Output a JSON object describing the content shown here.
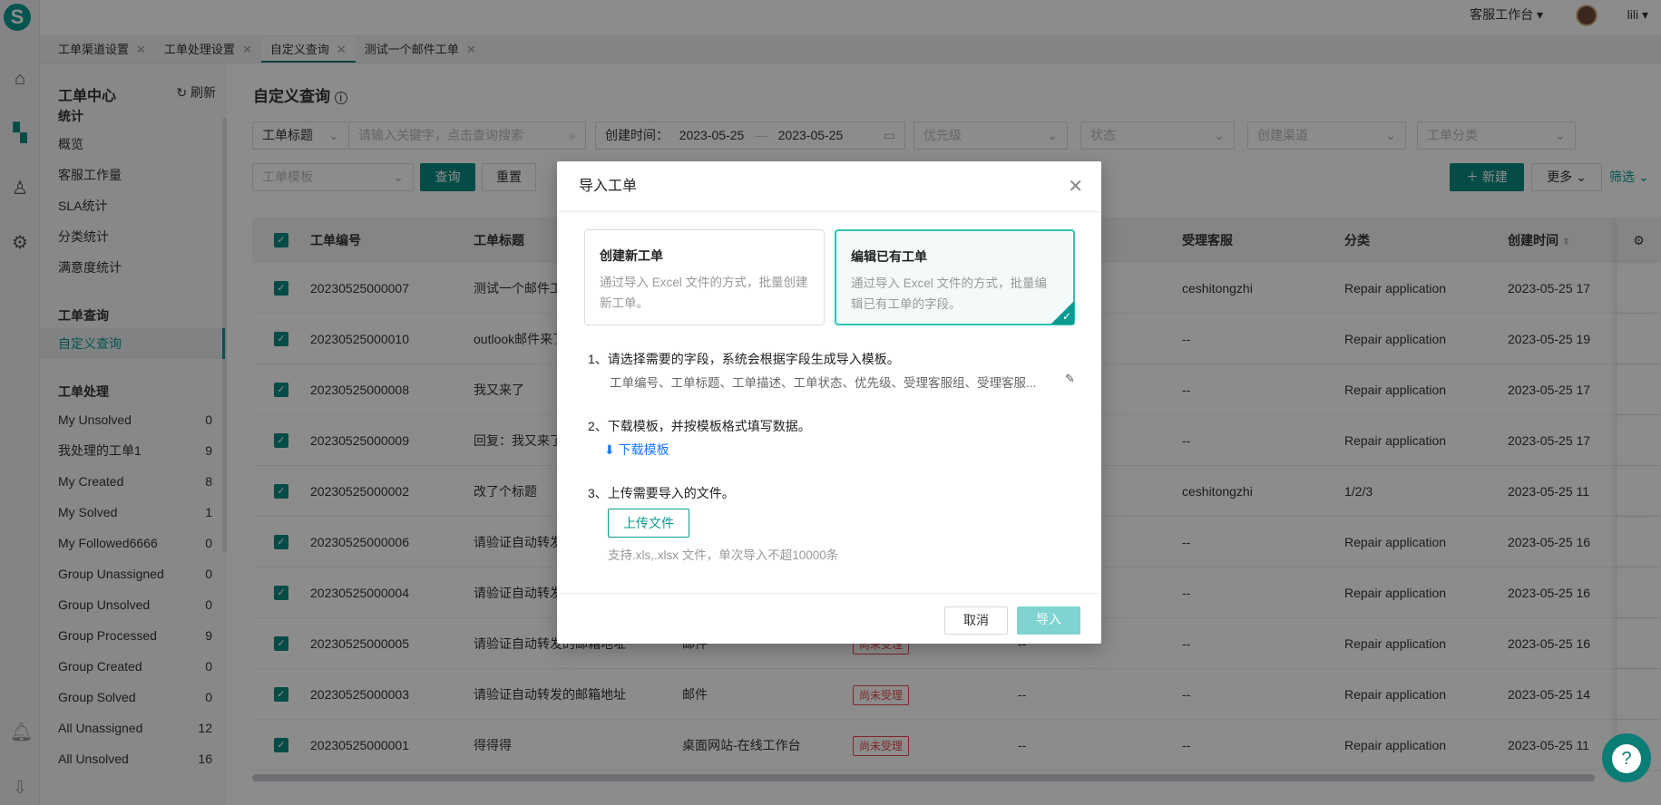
{
  "app": {
    "logo_letter": "S",
    "workspace": "客服工作台",
    "user": "lili"
  },
  "tabs": [
    {
      "label": "工单渠道设置"
    },
    {
      "label": "工单处理设置"
    },
    {
      "label": "自定义查询",
      "active": true
    },
    {
      "label": "测试一个邮件工单"
    }
  ],
  "sidebar": {
    "title": "工单中心",
    "refresh": "刷新",
    "groups": [
      {
        "label": "统计",
        "items": [
          {
            "label": "概览"
          },
          {
            "label": "客服工作量"
          },
          {
            "label": "SLA统计"
          },
          {
            "label": "分类统计"
          },
          {
            "label": "满意度统计"
          }
        ]
      },
      {
        "label": "工单查询",
        "items": [
          {
            "label": "自定义查询",
            "active": true
          }
        ]
      },
      {
        "label": "工单处理",
        "items": [
          {
            "label": "My Unsolved",
            "count": "0"
          },
          {
            "label": "我处理的工单1",
            "count": "9"
          },
          {
            "label": "My Created",
            "count": "8"
          },
          {
            "label": "My Solved",
            "count": "1"
          },
          {
            "label": "My Followed6666",
            "count": "0"
          },
          {
            "label": "Group Unassigned",
            "count": "0"
          },
          {
            "label": "Group Unsolved",
            "count": "0"
          },
          {
            "label": "Group Processed",
            "count": "9"
          },
          {
            "label": "Group Created",
            "count": "0"
          },
          {
            "label": "Group Solved",
            "count": "0"
          },
          {
            "label": "All Unassigned",
            "count": "12"
          },
          {
            "label": "All Unsolved",
            "count": "16"
          }
        ]
      }
    ]
  },
  "main": {
    "title": "自定义查询",
    "filters": {
      "field_select": "工单标题",
      "search_placeholder": "请输入关键字，点击查询搜索",
      "created_label": "创建时间：",
      "date_from": "2023-05-25",
      "date_to": "2023-05-25",
      "priority": "优先级",
      "status": "状态",
      "channel": "创建渠道",
      "category": "工单分类",
      "template": "工单模板",
      "query": "查询",
      "reset": "重置"
    },
    "actions": {
      "new": "新建",
      "more": "更多",
      "filter": "筛选"
    },
    "table": {
      "headers": {
        "id": "工单编号",
        "title": "工单标题",
        "agent": "受理客服",
        "category": "分类",
        "created": "创建时间"
      },
      "rows": [
        {
          "id": "20230525000007",
          "title": "测试一个邮件工单",
          "channel": "",
          "status": "",
          "c5": "",
          "agent": "ceshitongzhi",
          "category": "Repair application",
          "created": "2023-05-25 17"
        },
        {
          "id": "20230525000010",
          "title": "outlook邮件来了",
          "channel": "",
          "status": "",
          "c5": "",
          "agent": "--",
          "category": "Repair application",
          "created": "2023-05-25 19"
        },
        {
          "id": "20230525000008",
          "title": "我又来了",
          "channel": "",
          "status": "",
          "c5": "",
          "agent": "--",
          "category": "Repair application",
          "created": "2023-05-25 17"
        },
        {
          "id": "20230525000009",
          "title": "回复：我又来了",
          "channel": "",
          "status": "",
          "c5": "",
          "agent": "--",
          "category": "Repair application",
          "created": "2023-05-25 17"
        },
        {
          "id": "20230525000002",
          "title": "改了个标题",
          "channel": "",
          "status": "",
          "c5": "",
          "agent": "ceshitongzhi",
          "category": "1/2/3",
          "created": "2023-05-25 11"
        },
        {
          "id": "20230525000006",
          "title": "请验证自动转发的邮箱地址",
          "channel": "",
          "status": "",
          "c5": "",
          "agent": "--",
          "category": "Repair application",
          "created": "2023-05-25 16"
        },
        {
          "id": "20230525000004",
          "title": "请验证自动转发的邮箱地址",
          "channel": "",
          "status": "",
          "c5": "",
          "agent": "--",
          "category": "Repair application",
          "created": "2023-05-25 16"
        },
        {
          "id": "20230525000005",
          "title": "请验证自动转发的邮箱地址",
          "channel": "邮件",
          "status": "尚未受理",
          "c5": "--",
          "agent": "--",
          "category": "Repair application",
          "created": "2023-05-25 16"
        },
        {
          "id": "20230525000003",
          "title": "请验证自动转发的邮箱地址",
          "channel": "邮件",
          "status": "尚未受理",
          "c5": "--",
          "agent": "--",
          "category": "Repair application",
          "created": "2023-05-25 14"
        },
        {
          "id": "20230525000001",
          "title": "得得得",
          "channel": "桌面网站-在线工作台",
          "status": "尚未受理",
          "c5": "--",
          "agent": "--",
          "category": "Repair application",
          "created": "2023-05-25 11"
        }
      ]
    }
  },
  "modal": {
    "title": "导入工单",
    "cards": [
      {
        "title": "创建新工单",
        "desc": "通过导入 Excel 文件的方式，批量创建新工单。",
        "selected": false
      },
      {
        "title": "编辑已有工单",
        "desc": "通过导入 Excel 文件的方式，批量编辑已有工单的字段。",
        "selected": true
      }
    ],
    "step1": "1、请选择需要的字段，系统会根据字段生成导入模板。",
    "fields": "工单编号、工单标题、工单描述、工单状态、优先级、受理客服组、受理客服...",
    "step2": "2、下载模板，并按模板格式填写数据。",
    "download": "下载模板",
    "step3": "3、上传需要导入的文件。",
    "upload": "上传文件",
    "hint": "支持.xls,.xlsx 文件，单次导入不超10000条",
    "cancel": "取消",
    "import": "导入"
  },
  "colors": {
    "brand": "#0a8a82",
    "accent": "#2ec4b6",
    "danger": "#e5484d",
    "link": "#1677ff"
  }
}
